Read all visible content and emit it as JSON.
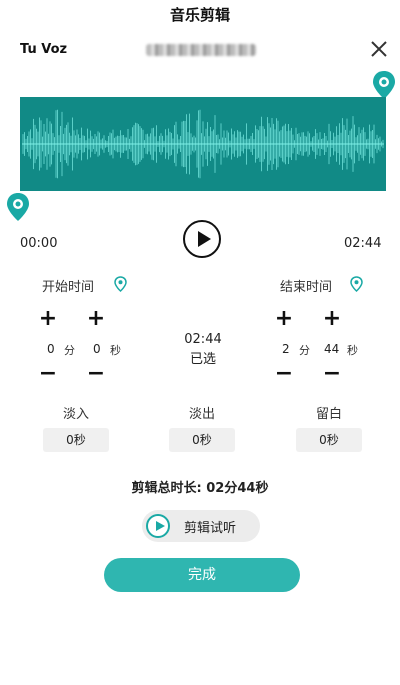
{
  "header": {
    "title": "音乐剪辑"
  },
  "track": {
    "title": "Tu Voz"
  },
  "player": {
    "current_time": "00:00",
    "total_time": "02:44"
  },
  "start": {
    "label": "开始时间",
    "minutes": "0",
    "minutes_unit": "分",
    "seconds": "0",
    "seconds_unit": "秒"
  },
  "end": {
    "label": "结束时间",
    "minutes": "2",
    "minutes_unit": "分",
    "seconds": "44",
    "seconds_unit": "秒"
  },
  "selection": {
    "duration": "02:44",
    "label": "已选"
  },
  "effects": {
    "fade_in_label": "淡入",
    "fade_in_value": "0秒",
    "fade_out_label": "淡出",
    "fade_out_value": "0秒",
    "silence_label": "留白",
    "silence_value": "0秒"
  },
  "total": {
    "text": "剪辑总时长: 02分44秒"
  },
  "buttons": {
    "preview": "剪辑试听",
    "done": "完成"
  },
  "colors": {
    "accent": "#2fb6b0",
    "wave_bg": "#118a86",
    "wave": "#7ff0e8"
  },
  "icons": {
    "close": "close-icon",
    "play": "play-icon",
    "location": "location-pin-icon"
  }
}
